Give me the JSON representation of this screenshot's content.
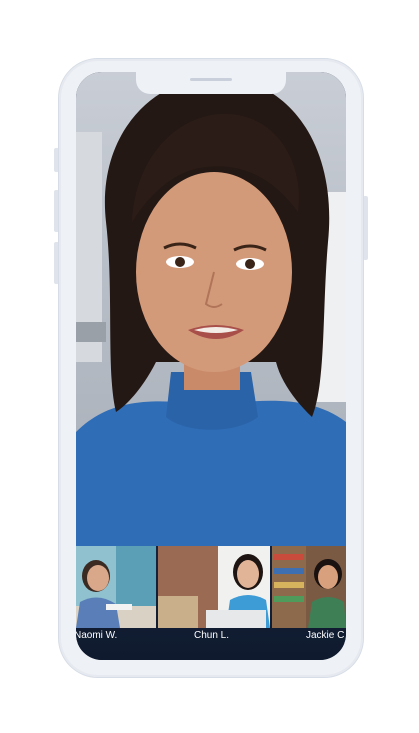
{
  "call": {
    "active_speaker": "main-video-feed",
    "participants": [
      {
        "name": "Naomi W."
      },
      {
        "name": "Chun L."
      },
      {
        "name": "Jackie C"
      }
    ]
  },
  "colors": {
    "phone_frame": "#eef1f6",
    "strip_background": "#16233b",
    "name_text": "#ffffff"
  }
}
